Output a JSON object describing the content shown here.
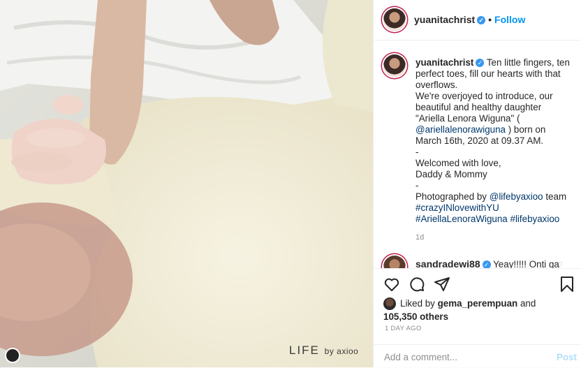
{
  "photo": {
    "watermark_main": "LIFE",
    "watermark_sub": "by axioo"
  },
  "header": {
    "username": "yuanitachrist",
    "verified_icon": "✓",
    "separator": "•",
    "follow_label": "Follow"
  },
  "caption": {
    "username": "yuanitachrist",
    "lines": [
      "Ten little fingers, ten perfect toes, fill our hearts with that overflows.",
      "We're overjoyed to introduce, our beautiful and healthy daughter \"Ariella Lenora Wiguna\" (",
      "@ariellalenorawiguna",
      ") born on March 16th, 2020 at 09.37 AM.",
      "-",
      "Welcomed with love,",
      "Daddy & Mommy",
      "-",
      "Photographed by ",
      "@lifebyaxioo",
      " team",
      "#crazyINlovewithYU",
      "#AriellaLenoraWiguna",
      "#lifebyaxioo"
    ],
    "age": "1d"
  },
  "comment2": {
    "username": "sandradewi88",
    "text": "Yeay!!!!! Onti ga"
  },
  "likes": {
    "prefix": "Liked by ",
    "user": "gema_perempuan",
    "and": " and",
    "count": "105,350 others"
  },
  "timestamp": "1 DAY AGO",
  "add_comment": {
    "placeholder": "Add a comment...",
    "post_label": "Post"
  },
  "icons": {
    "like": "heart-icon",
    "comment": "comment-icon",
    "share": "share-icon",
    "save": "bookmark-icon"
  }
}
